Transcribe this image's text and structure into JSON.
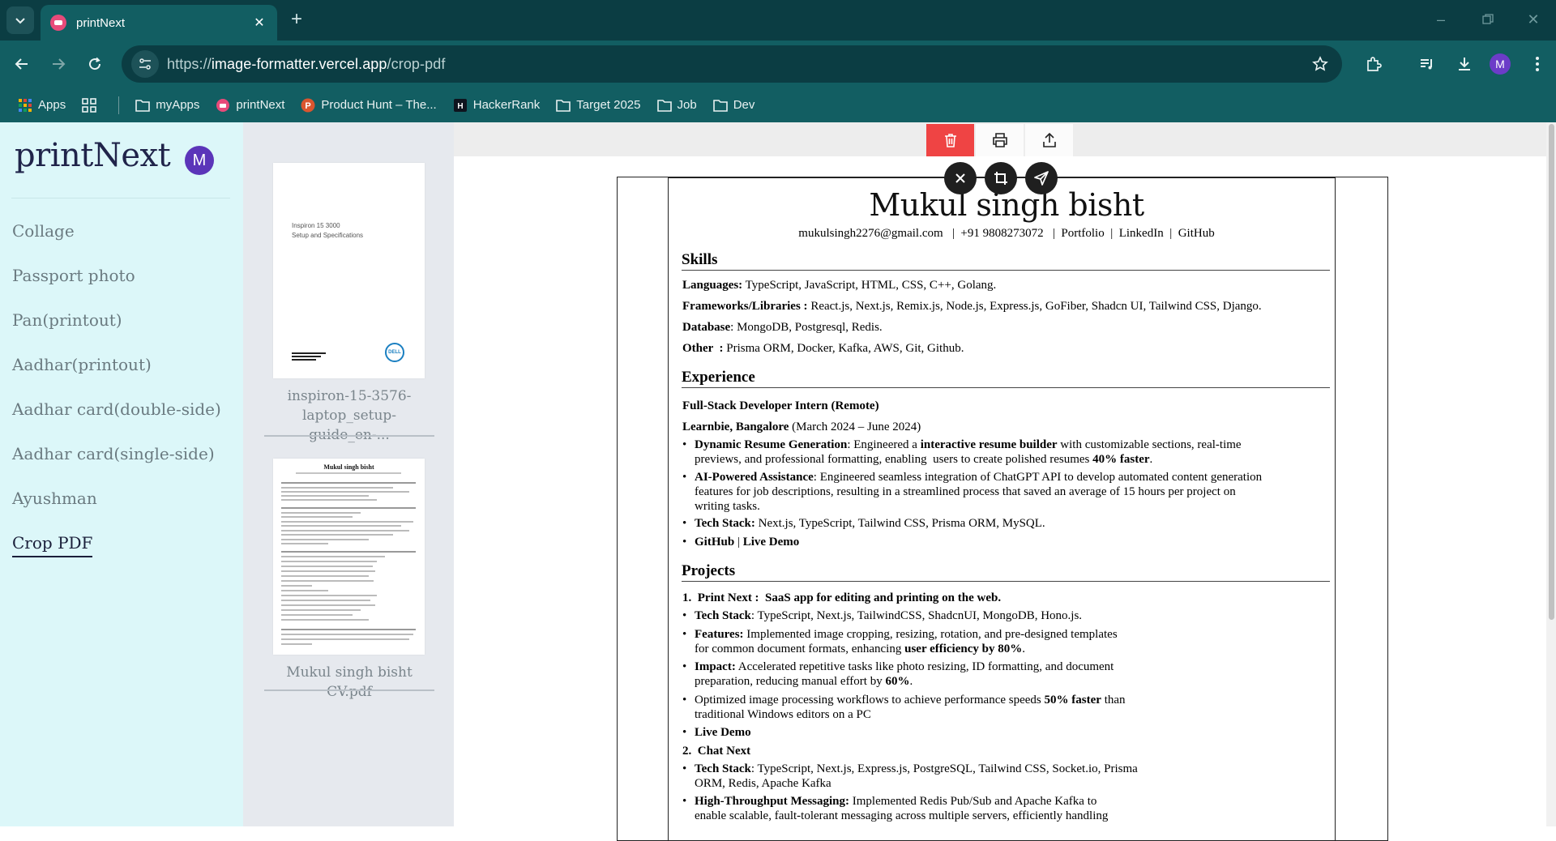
{
  "browser": {
    "tab_title": "printNext",
    "url_scheme": "https://",
    "url_host": "image-formatter.vercel.app",
    "url_path": "/crop-pdf",
    "profile_initial": "M",
    "bookmarks": [
      {
        "label": "Apps",
        "icon": "apps-grid-icon"
      },
      {
        "label": "",
        "icon": "tab-groups-icon"
      },
      {
        "label": "myApps",
        "icon": "folder-icon"
      },
      {
        "label": "printNext",
        "icon": "printnext-favicon"
      },
      {
        "label": "Product Hunt – The...",
        "icon": "product-hunt-icon"
      },
      {
        "label": "HackerRank",
        "icon": "hackerrank-icon"
      },
      {
        "label": "Target 2025",
        "icon": "folder-icon"
      },
      {
        "label": "Job",
        "icon": "folder-icon"
      },
      {
        "label": "Dev",
        "icon": "folder-icon"
      }
    ]
  },
  "sidebar": {
    "brand": "printNext",
    "avatar_initial": "M",
    "items": [
      {
        "label": "Collage"
      },
      {
        "label": "Passport photo"
      },
      {
        "label": "Pan(printout)"
      },
      {
        "label": "Aadhar(printout)"
      },
      {
        "label": "Aadhar card(double-side)"
      },
      {
        "label": "Aadhar card(single-side)"
      },
      {
        "label": "Ayushman"
      },
      {
        "label": "Crop PDF"
      }
    ],
    "active_index": 7
  },
  "files": [
    {
      "name_line1": "inspiron-15-3576-",
      "name_line2": "laptop_setup-guide_en-...",
      "thumb_title": "Inspiron 15 3000",
      "thumb_subtitle": "Setup and Specifications",
      "thumb_logo": "DELL"
    },
    {
      "name_line1": "Mukul singh bisht CV.pdf",
      "name_line2": "",
      "thumb_title": "Mukul singh bisht"
    }
  ],
  "toolbar": {
    "buttons": [
      {
        "icon": "trash-icon",
        "state": "danger"
      },
      {
        "icon": "printer-icon"
      },
      {
        "icon": "upload-icon"
      }
    ],
    "floating": [
      {
        "icon": "close-icon"
      },
      {
        "icon": "crop-icon"
      },
      {
        "icon": "send-icon"
      }
    ]
  },
  "resume": {
    "name": "Mukul singh bisht",
    "contact": "mukulsingh2276@gmail.com   |  +91 9808273072   |  Portfolio  |  LinkedIn  |  GitHub",
    "skills_title": "Skills",
    "skills": [
      {
        "k": "Languages:",
        "v": " TypeScript, JavaScript, HTML, CSS, C++, Golang."
      },
      {
        "k": "Frameworks/Libraries :",
        "v": " React.js, Next.js, Remix.js, Node.js, Express.js, GoFiber, Shadcn UI, Tailwind CSS, Django."
      },
      {
        "k": "Database",
        "v": ": MongoDB, Postgresql, Redis."
      },
      {
        "k": "Other  :",
        "v": " Prisma ORM, Docker, Kafka, AWS, Git, Github."
      }
    ],
    "experience_title": "Experience",
    "exp_role": "Full-Stack Developer Intern (Remote)",
    "exp_company": "Learnbie, Bangalore",
    "exp_dates": " (March 2024 – June 2024)",
    "exp_bullets": [
      {
        "k": "Dynamic Resume Generation",
        "l1": ": Engineered a ",
        "b1": "interactive resume builder",
        "l2": " with customizable sections, real-time",
        "l3": "previews, and professional formatting, enabling  users to create polished resumes ",
        "b2": "40% faster",
        "l4": "."
      },
      {
        "k": "AI-Powered Assistance",
        "l1": ": Engineered seamless integration of ChatGPT API to develop automated content generation",
        "l2": "features for job descriptions, resulting in a streamlined process that saved an average of 15 hours per project on",
        "l3": "writing tasks."
      },
      {
        "k": "Tech Stack:",
        "l1": " Next.js, TypeScript, Tailwind CSS, Prisma ORM, MySQL."
      },
      {
        "k": "GitHub",
        "l1": " | ",
        "b1": "Live Demo"
      }
    ],
    "projects_title": "Projects",
    "p1_title": "1.  Print Next :  SaaS app for editing and printing on the web.",
    "p1_bullets": [
      {
        "k": "Tech Stack",
        "l1": ": TypeScript, Next.js, TailwindCSS, ShadcnUI, MongoDB, Hono.js."
      },
      {
        "k": "Features:",
        "l1": " Implemented image cropping, resizing, rotation, and pre-designed templates",
        "l2": "for common document formats, enhancing ",
        "b2": "user efficiency by 80%",
        "l3": "."
      },
      {
        "k": "Impact:",
        "l1": " Accelerated repetitive tasks like photo resizing, ID formatting, and document",
        "l2": "preparation, reducing manual effort by ",
        "b2": "60%",
        "l3": "."
      },
      {
        "k": "",
        "l1": "Optimized image processing workflows to achieve performance speeds ",
        "b1": "50% faster",
        "l1b": " than",
        "l2": "traditional Windows editors on a PC"
      },
      {
        "k": "Live Demo",
        "l1": ""
      }
    ],
    "p2_title": "2.  Chat Next",
    "p2_bullets": [
      {
        "k": "Tech Stack",
        "l1": ": TypeScript, Next.js, Express.js, PostgreSQL, Tailwind CSS, Socket.io, Prisma",
        "l2": "ORM, Redis, Apache Kafka"
      },
      {
        "k": "High-Throughput Messaging:",
        "l1": " Implemented Redis Pub/Sub and Apache Kafka to",
        "l2": "enable scalable, fault-tolerant messaging across multiple servers, efficiently handling"
      }
    ]
  },
  "colors": {
    "chrome_dark": "#0b3d43",
    "chrome": "#125e62",
    "sidebar_bg": "#dcf7f9",
    "danger": "#ef4444",
    "avatar": "#5b35b9"
  }
}
